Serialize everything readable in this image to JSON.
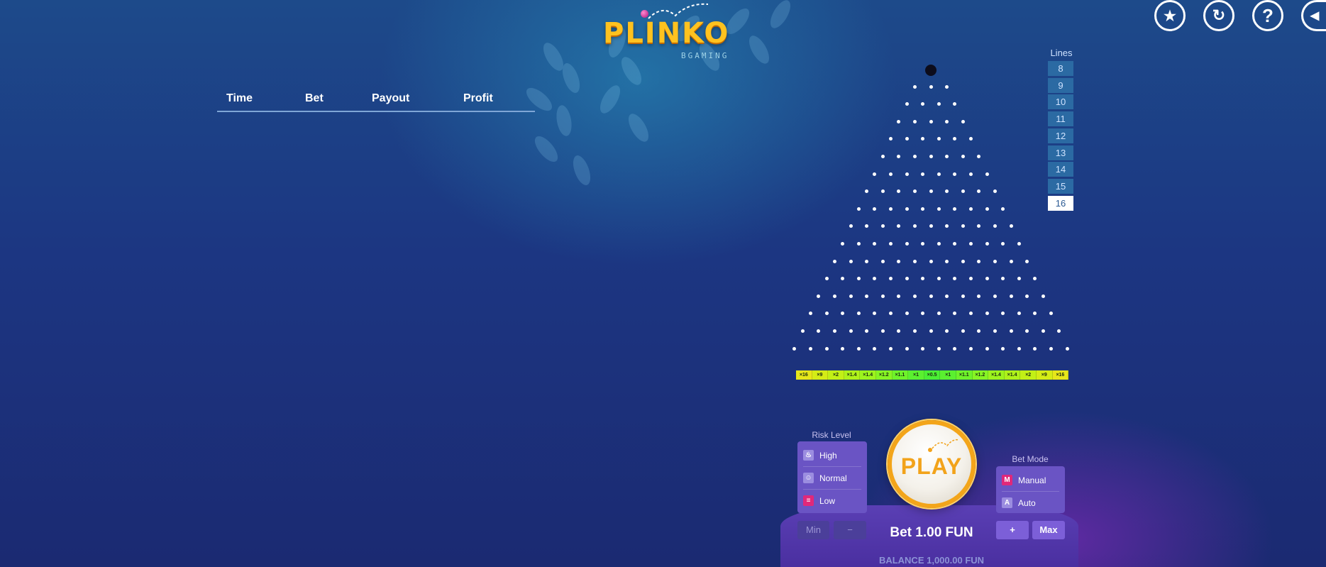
{
  "logo": {
    "title": "PLINKO",
    "provider": "BGAMING"
  },
  "top_icons": [
    {
      "name": "achievements-icon",
      "glyph": "★"
    },
    {
      "name": "history-icon",
      "glyph": "↻"
    },
    {
      "name": "help-icon",
      "glyph": "?"
    },
    {
      "name": "sound-icon",
      "glyph": "◀"
    }
  ],
  "history": {
    "columns": [
      "Time",
      "Bet",
      "Payout",
      "Profit"
    ],
    "rows": []
  },
  "board": {
    "rows": 16,
    "multipliers": [
      "×16",
      "×9",
      "×2",
      "×1.4",
      "×1.4",
      "×1.2",
      "×1.1",
      "×1",
      "×0.5",
      "×1",
      "×1.1",
      "×1.2",
      "×1.4",
      "×1.4",
      "×2",
      "×9",
      "×16"
    ],
    "slot_colors": [
      "#e6e61a",
      "#d4ec16",
      "#c2f016",
      "#aef21a",
      "#9cf41e",
      "#86f424",
      "#6ef22a",
      "#5af030",
      "#4aee34",
      "#5af030",
      "#6ef22a",
      "#86f424",
      "#9cf41e",
      "#aef21a",
      "#c2f016",
      "#d4ec16",
      "#e6e61a"
    ]
  },
  "lines": {
    "label": "Lines",
    "options": [
      "8",
      "9",
      "10",
      "11",
      "12",
      "13",
      "14",
      "15",
      "16"
    ],
    "selected": "16"
  },
  "risk": {
    "label": "Risk Level",
    "options": [
      {
        "label": "High",
        "icon": "flame-icon",
        "glyph": "♨"
      },
      {
        "label": "Normal",
        "icon": "face-icon",
        "glyph": "☺"
      },
      {
        "label": "Low",
        "icon": "lock-icon",
        "glyph": "≡"
      }
    ],
    "selected": "Low"
  },
  "bet_mode": {
    "label": "Bet Mode",
    "options": [
      {
        "label": "Manual",
        "glyph": "M"
      },
      {
        "label": "Auto",
        "glyph": "A"
      }
    ],
    "selected": "Manual"
  },
  "controls": {
    "min": "Min",
    "minus": "−",
    "plus": "+",
    "max": "Max",
    "play": "PLAY"
  },
  "bet": "Bet 1.00 FUN",
  "balance": "BALANCE 1,000.00 FUN",
  "colors": {
    "accent": "#f2a31b",
    "selected": "#e0287a",
    "panel": "#6a54c4"
  }
}
